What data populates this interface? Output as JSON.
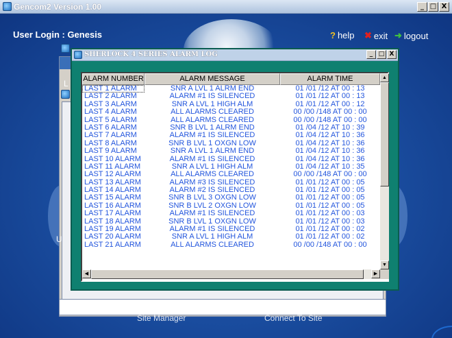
{
  "app": {
    "title": "Gencom2  Version 1.00",
    "user_login": "User Login : Genesis",
    "help_label": "help",
    "exit_label": "exit",
    "logout_label": "logout",
    "help_icon": "?",
    "exit_icon": "✖",
    "logout_icon": "➜",
    "minimize": "_",
    "maximize": "□",
    "close": "X",
    "site_manager": "Site Manager",
    "connect_to_site": "Connect To Site",
    "side_letters": [
      "L",
      "U"
    ]
  },
  "alarm_window": {
    "title": "SHERLOCK 4 SERIES ALARM LOG",
    "minimize": "_",
    "maximize": "□",
    "close": "X",
    "columns": [
      "ALARM NUMBER",
      "ALARM MESSAGE",
      "ALARM TIME"
    ],
    "rows": [
      [
        "LAST 1 ALARM",
        "SNR A LVL 1 ALRM END",
        "01 /01 /12   AT  00 : 13"
      ],
      [
        "LAST 2 ALARM",
        "ALARM #1 IS SILENCED",
        "01 /01 /12   AT  00 : 13"
      ],
      [
        "LAST 3 ALARM",
        "SNR A LVL 1 HIGH ALM",
        "01 /01 /12   AT  00 : 12"
      ],
      [
        "LAST 4 ALARM",
        "ALL ALARMS CLEARED",
        "00 /00 /148  AT  00 : 00"
      ],
      [
        "LAST 5 ALARM",
        "ALL ALARMS CLEARED",
        "00 /00 /148  AT  00 : 00"
      ],
      [
        "LAST 6 ALARM",
        "SNR B LVL 1 ALRM END",
        "01 /04 /12   AT  10 : 39"
      ],
      [
        "LAST 7 ALARM",
        "ALARM #1 IS SILENCED",
        "01 /04 /12   AT  10 : 36"
      ],
      [
        "LAST 8 ALARM",
        "SNR B LVL 1 OXGN LOW",
        "01 /04 /12   AT  10 : 36"
      ],
      [
        "LAST 9 ALARM",
        "SNR A LVL 1 ALRM END",
        "01 /04 /12   AT  10 : 36"
      ],
      [
        "LAST 10 ALARM",
        "ALARM #1 IS SILENCED",
        "01 /04 /12   AT  10 : 36"
      ],
      [
        "LAST 11 ALARM",
        "SNR A LVL 1 HIGH ALM",
        "01 /04 /12   AT  10 : 35"
      ],
      [
        "LAST 12 ALARM",
        "ALL ALARMS CLEARED",
        "00 /00 /148  AT  00 : 00"
      ],
      [
        "LAST 13 ALARM",
        "ALARM #3 IS SILENCED",
        "01 /01 /12   AT  00 : 05"
      ],
      [
        "LAST 14 ALARM",
        "ALARM #2 IS SILENCED",
        "01 /01 /12   AT  00 : 05"
      ],
      [
        "LAST 15 ALARM",
        "SNR B LVL 3 OXGN LOW",
        "01 /01 /12   AT  00 : 05"
      ],
      [
        "LAST 16 ALARM",
        "SNR B LVL 2 OXGN LOW",
        "01 /01 /12   AT  00 : 05"
      ],
      [
        "LAST 17 ALARM",
        "ALARM #1 IS SILENCED",
        "01 /01 /12   AT  00 : 03"
      ],
      [
        "LAST 18 ALARM",
        "SNR B LVL 1 OXGN LOW",
        "01 /01 /12   AT  00 : 03"
      ],
      [
        "LAST 19 ALARM",
        "ALARM #1 IS SILENCED",
        "01 /01 /12   AT  00 : 02"
      ],
      [
        "LAST 20 ALARM",
        "SNR A LVL 1 HIGH ALM",
        "01 /01 /12   AT  00 : 02"
      ],
      [
        "LAST 21 ALARM",
        "ALL ALARMS CLEARED",
        "00 /00 /148  AT  00 : 00"
      ]
    ],
    "scroll_up": "▲",
    "scroll_down": "▼",
    "scroll_left": "◀",
    "scroll_right": "▶"
  },
  "colors": {
    "alarm_text": "#2255dd",
    "alarm_window_bg": "#0f8070",
    "desktop_bg": "#1b4fa2"
  }
}
